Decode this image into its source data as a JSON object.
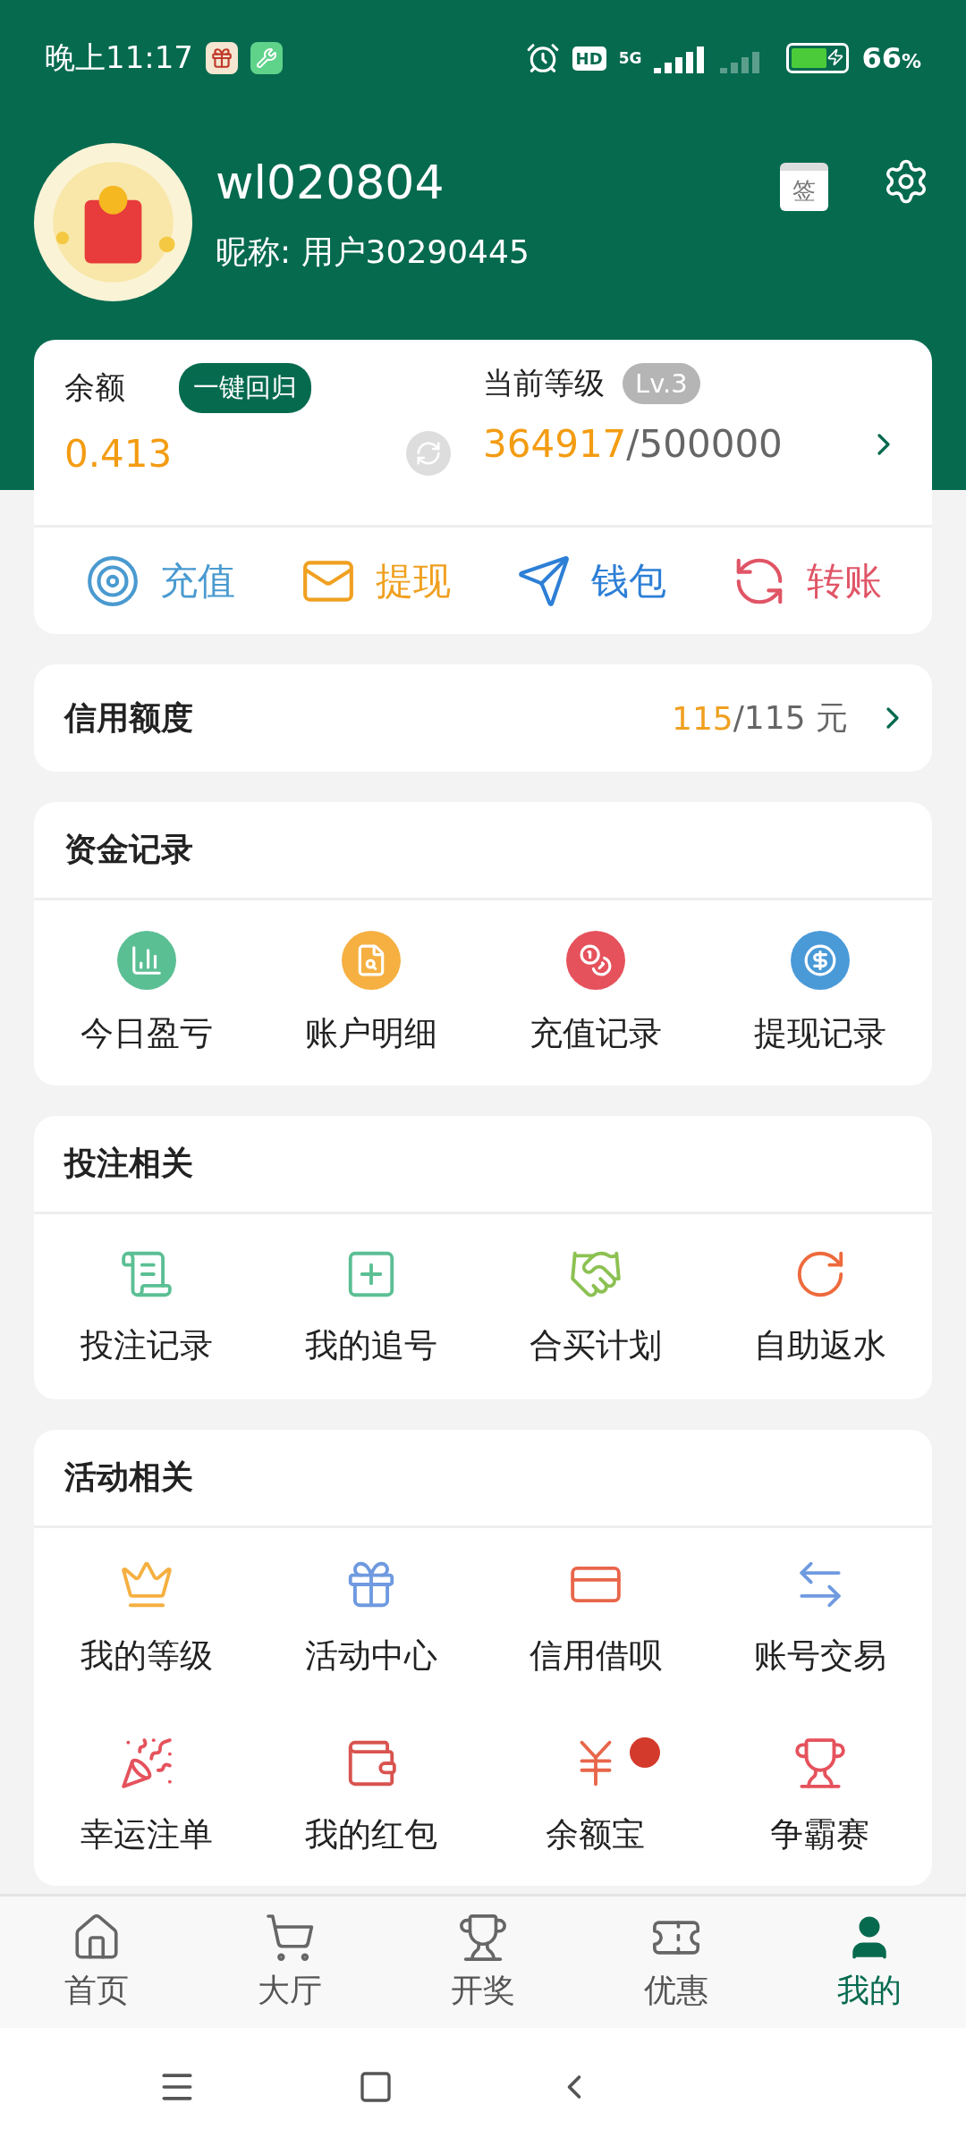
{
  "status_bar": {
    "time": "晚上11:17",
    "hd": "HD",
    "network": "5G",
    "battery": "66",
    "battery_unit": "%"
  },
  "profile": {
    "username": "wl020804",
    "nickname": "昵称: 用户30290445",
    "sign_button": "签"
  },
  "balance_card": {
    "balance_label": "余额",
    "return_button": "一键回归",
    "balance": "0.413",
    "level_label": "当前等级",
    "level_badge": "Lv.3",
    "points": "364917",
    "points_max": "/500000",
    "actions": [
      {
        "label": "充值",
        "color": "#4a9ad0"
      },
      {
        "label": "提现",
        "color": "#f0a020"
      },
      {
        "label": "钱包",
        "color": "#2d7fd6"
      },
      {
        "label": "转账",
        "color": "#e05566"
      }
    ]
  },
  "credit": {
    "label": "信用额度",
    "used": "115",
    "total": "/115 元"
  },
  "sections": [
    {
      "title": "资金记录",
      "items": [
        {
          "label": "今日盈亏",
          "badge": false
        },
        {
          "label": "账户明细",
          "badge": false
        },
        {
          "label": "充值记录",
          "badge": false
        },
        {
          "label": "提现记录",
          "badge": false
        }
      ]
    },
    {
      "title": "投注相关",
      "items": [
        {
          "label": "投注记录",
          "badge": false
        },
        {
          "label": "我的追号",
          "badge": false
        },
        {
          "label": "合买计划",
          "badge": false
        },
        {
          "label": "自助返水",
          "badge": false
        }
      ]
    },
    {
      "title": "活动相关",
      "items": [
        {
          "label": "我的等级",
          "badge": false
        },
        {
          "label": "活动中心",
          "badge": false
        },
        {
          "label": "信用借呗",
          "badge": false
        },
        {
          "label": "账号交易",
          "badge": false
        },
        {
          "label": "幸运注单",
          "badge": false
        },
        {
          "label": "我的红包",
          "badge": false
        },
        {
          "label": "余额宝",
          "badge": true
        },
        {
          "label": "争霸赛",
          "badge": false
        }
      ]
    }
  ],
  "tab_bar": [
    {
      "label": "首页",
      "selected": false
    },
    {
      "label": "大厅",
      "selected": false
    },
    {
      "label": "开奖",
      "selected": false
    },
    {
      "label": "优惠",
      "selected": false
    },
    {
      "label": "我的",
      "selected": true
    }
  ]
}
